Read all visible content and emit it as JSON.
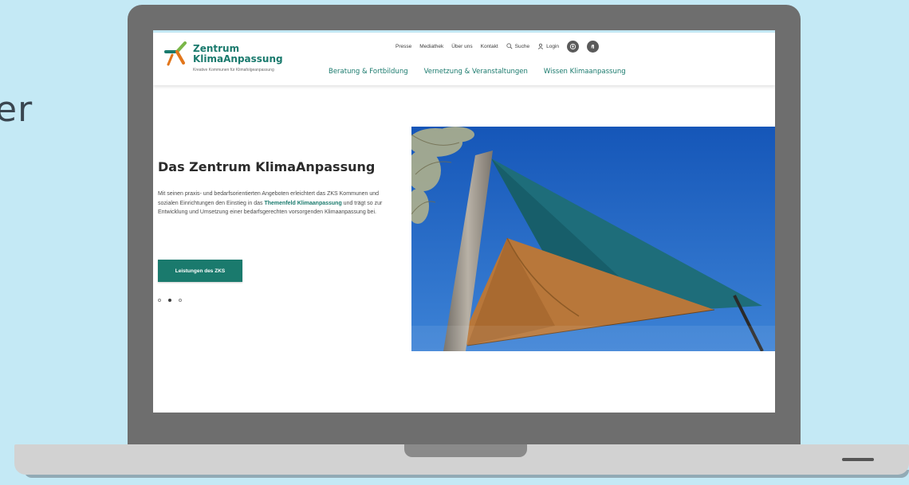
{
  "background_text": "er",
  "site": {
    "logo": {
      "title_line1": "Zentrum",
      "title_line2": "KlimaAnpassung",
      "subtitle": "Kreative Kommunen für Klimafolgeanpassung"
    },
    "meta_nav": {
      "links": [
        "Presse",
        "Mediathek",
        "Über uns",
        "Kontakt"
      ],
      "search_label": "Suche",
      "login_label": "Login"
    },
    "main_nav": [
      "Beratung & Fortbildung",
      "Vernetzung & Veranstaltungen",
      "Wissen Klimaanpassung"
    ],
    "hero": {
      "title": "Das Zentrum KlimaAnpassung",
      "text_before": "Mit seinen praxis- und bedarfsorientierten Angeboten erleichtert das ZKS Kommunen und sozialen Einrichtungen den Einstieg in das ",
      "text_link": "Themenfeld Klimaanpassung",
      "text_after": " und trägt so zur Entwicklung und Umsetzung einer bedarfsgerechten vorsorgenden Klimaanpassung bei.",
      "button_label": "Leistungen des ZKS",
      "dots": [
        false,
        true,
        false
      ]
    }
  },
  "colors": {
    "page_background": "#c4e9f5",
    "brand_teal": "#1a7a6d",
    "laptop_frame": "#6e6e6e",
    "laptop_base": "#d2d2d2"
  }
}
